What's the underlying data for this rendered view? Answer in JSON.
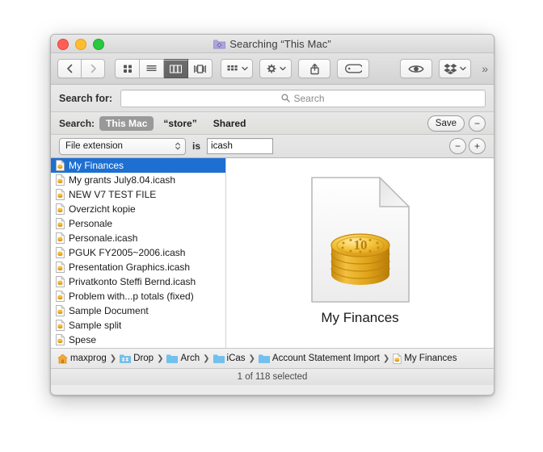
{
  "window": {
    "title": "Searching “This Mac”",
    "title_icon": "smart-folder-icon",
    "traffic_lights": [
      "close-red",
      "minimize-yellow",
      "zoom-green"
    ]
  },
  "toolbar": {
    "back_icon": "chevron-left-icon",
    "forward_icon": "chevron-right-icon",
    "view_modes": [
      {
        "name": "icon-view",
        "icon": "grid-icon",
        "active": false
      },
      {
        "name": "list-view",
        "icon": "lines-icon",
        "active": false
      },
      {
        "name": "column-view",
        "icon": "columns-icon",
        "active": true
      },
      {
        "name": "coverflow-view",
        "icon": "coverflow-icon",
        "active": false
      }
    ],
    "arrange_icon": "arrange-grid-icon",
    "action_icon": "gear-icon",
    "share_icon": "share-icon",
    "tag_icon": "tag-icon",
    "quicklook_icon": "eye-icon",
    "dropbox_icon": "dropbox-icon",
    "overflow_label": "»"
  },
  "search_for": {
    "label": "Search for:",
    "placeholder": "Search",
    "value": "",
    "icon": "search-icon"
  },
  "scope": {
    "label": "Search:",
    "options": [
      {
        "label": "This Mac",
        "selected": true
      },
      {
        "label": "“store”",
        "selected": false
      },
      {
        "label": "Shared",
        "selected": false
      }
    ],
    "save_label": "Save",
    "remove_label": "−"
  },
  "criteria": {
    "attribute": "File extension",
    "operator": "is",
    "value": "icash",
    "remove_label": "−",
    "add_label": "+"
  },
  "file_list": [
    {
      "name": "My Finances",
      "selected": true
    },
    {
      "name": "My grants July8.04.icash",
      "selected": false
    },
    {
      "name": "NEW V7 TEST FILE",
      "selected": false
    },
    {
      "name": "Overzicht kopie",
      "selected": false
    },
    {
      "name": "Personale",
      "selected": false
    },
    {
      "name": "Personale.icash",
      "selected": false
    },
    {
      "name": "PGUK FY2005~2006.icash",
      "selected": false
    },
    {
      "name": "Presentation Graphics.icash",
      "selected": false
    },
    {
      "name": "Privatkonto Steffi Bernd.icash",
      "selected": false
    },
    {
      "name": "Problem with...p totals (fixed)",
      "selected": false
    },
    {
      "name": "Sample Document",
      "selected": false
    },
    {
      "name": "Sample split",
      "selected": false
    },
    {
      "name": "Spese",
      "selected": false
    }
  ],
  "preview": {
    "name": "My Finances",
    "icon": "icash-document-icon"
  },
  "path_bar": [
    {
      "label": "maxprog",
      "icon": "home-icon"
    },
    {
      "label": "Drop",
      "icon": "dropbox-folder-icon"
    },
    {
      "label": "Arch",
      "icon": "folder-icon"
    },
    {
      "label": "iCas",
      "icon": "folder-icon"
    },
    {
      "label": "Account Statement Import",
      "icon": "folder-icon"
    },
    {
      "label": "My Finances",
      "icon": "icash-file-icon"
    }
  ],
  "status": {
    "text": "1 of 118 selected"
  },
  "colors": {
    "selection_blue": "#1d6fd2",
    "scope_pill_gray": "#999999",
    "coin_gold": "#e8a317",
    "folder_blue": "#6fc2f0",
    "smart_folder_purple": "#a99ad4"
  }
}
